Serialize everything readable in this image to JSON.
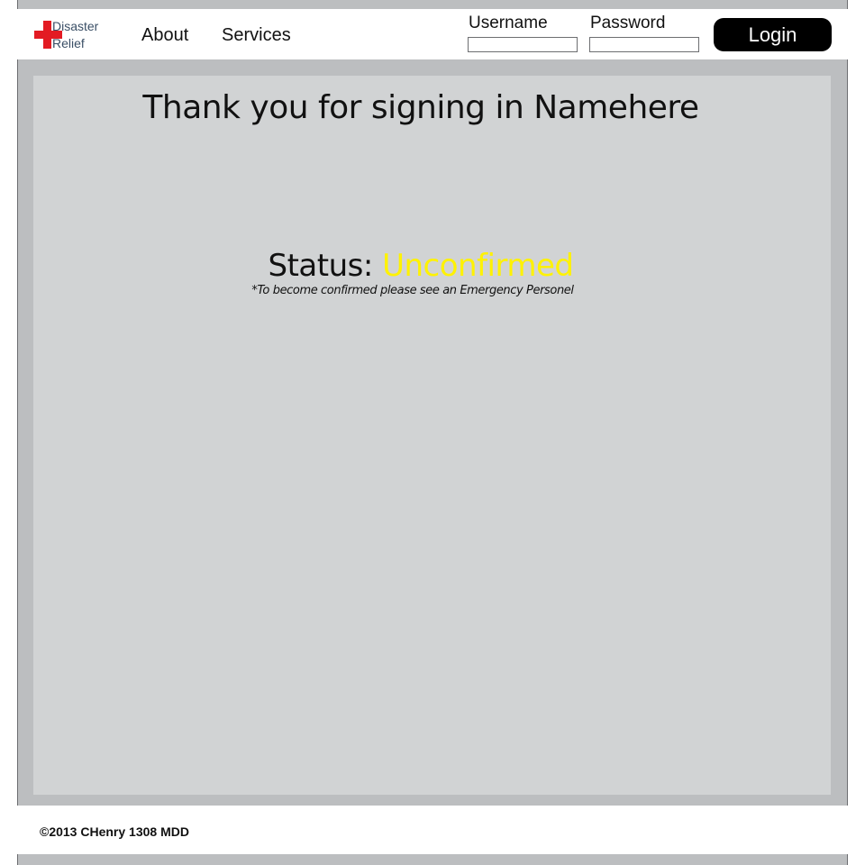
{
  "header": {
    "logo": {
      "line1": "Disaster",
      "line2": "Relief",
      "icon": "red-cross-icon",
      "icon_color": "#e31b23",
      "text_color": "#3a4f66"
    },
    "nav": [
      {
        "label": "About"
      },
      {
        "label": "Services"
      }
    ],
    "login_form": {
      "username_label": "Username",
      "username_value": "",
      "password_label": "Password",
      "password_value": "",
      "login_label": "Login"
    }
  },
  "main": {
    "title": "Thank you for signing in Namehere",
    "status_label": "Status:",
    "status_value": "Unconfirmed",
    "status_value_color": "#fff200",
    "status_note": "*To become confirmed please see an Emergency  Personel"
  },
  "footer": {
    "copyright": "©2013 CHenry 1308 MDD"
  },
  "colors": {
    "frame": "#bcbec0",
    "panel": "#d1d3d4",
    "button_bg": "#000000",
    "button_text": "#ffffff"
  }
}
